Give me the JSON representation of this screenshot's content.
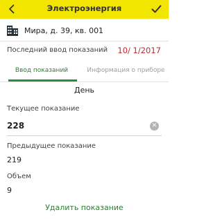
{
  "header": {
    "title": "Электроэнергия",
    "back_icon": "chevron-left-icon",
    "done_icon": "checkmark-icon",
    "background": "#f2e600"
  },
  "address": {
    "icon": "building-icon",
    "text": "Мира, д. 39, кв. 001"
  },
  "last_reading": {
    "label": "Последний ввод показаний",
    "date": "10/ 1/2017",
    "date_color": "#c62828"
  },
  "tabs": [
    {
      "label": "Ввод показаний",
      "active": true
    },
    {
      "label": "Информация о приборе",
      "active": false
    }
  ],
  "section_title": "День",
  "fields": {
    "current": {
      "label": "Текущее показание",
      "value": "228"
    },
    "previous": {
      "label": "Предыдущее показание",
      "value": "219"
    },
    "volume": {
      "label": "Объем",
      "value": "9"
    }
  },
  "actions": {
    "delete_label": "Удалить показание",
    "accent_color": "#2e7d32"
  }
}
